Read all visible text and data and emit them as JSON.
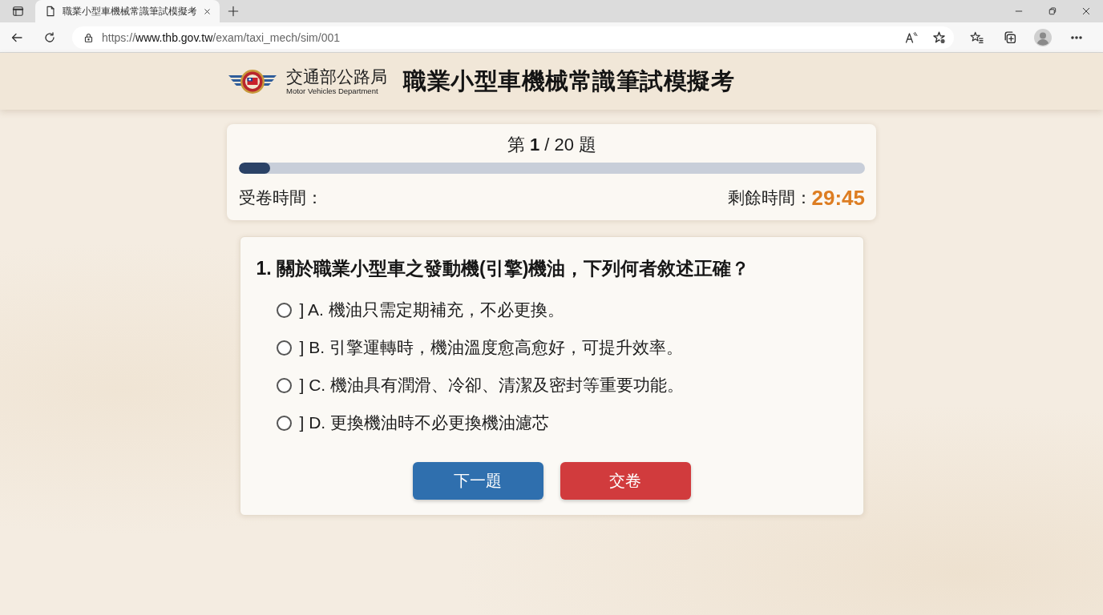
{
  "browser": {
    "tabs": [
      {
        "title": "職業小型車機械常識筆試模擬考",
        "selected": true
      }
    ],
    "url": "https://**www.thb.gov.tw**/exam/taxi_mech/sim/001"
  },
  "header": {
    "agency_name": "交通部公路局",
    "agency_subtitle": "Motor Vehicles Department",
    "title": "職業小型車機械常識筆試模擬考"
  },
  "progress": {
    "counter": "第 **1** / 20 題",
    "level": 0.05,
    "start_time_label": "受卷時間：",
    "remaining_label": "剩餘時間：",
    "remaining_time": "29:45"
  },
  "question": {
    "text": "1. 關於職業小型車之發動機(引擎)機油，下列何者敘述正確？",
    "options": [
      {
        "label": "] A. 機油只需定期補充，不必更換。",
        "selected": false
      },
      {
        "label": "] B. 引擎運轉時，機油溫度愈高愈好，可提升效率。",
        "selected": false
      },
      {
        "label": "] C. 機油具有潤滑、冷卻、清潔及密封等重要功能。",
        "selected": false
      },
      {
        "label": "] D. 更換機油時不必更換機油濾芯",
        "selected": false
      }
    ]
  },
  "buttons": [
    {
      "label": "下一題",
      "kind": "primary"
    },
    {
      "label": "交卷",
      "kind": "danger"
    }
  ]
}
